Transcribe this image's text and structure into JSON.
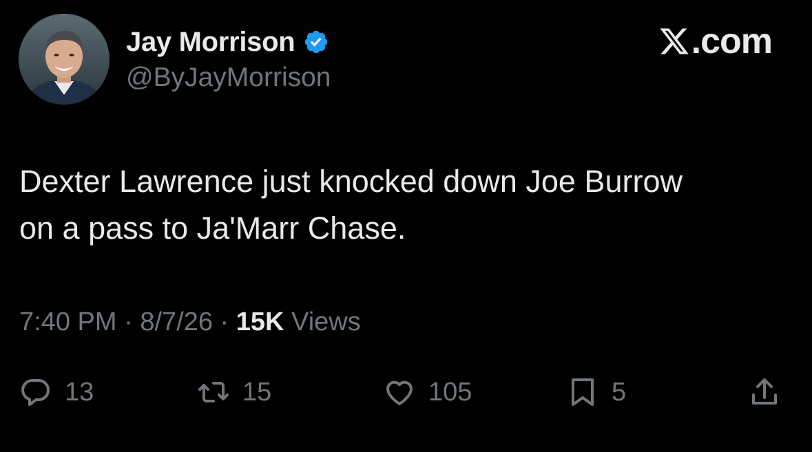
{
  "author": {
    "display_name": "Jay Morrison",
    "handle": "@ByJayMorrison",
    "verified_icon": "verified-badge-icon",
    "verified_color": "#1d9bf0"
  },
  "brand": {
    "text": ".com",
    "icon": "x-logo-icon"
  },
  "tweet": {
    "text": "Dexter Lawrence just knocked down Joe Burrow\non a pass to Ja'Marr Chase."
  },
  "meta": {
    "time": "7:40 PM",
    "separator": "·",
    "date": "8/7/26",
    "views_count": "15K",
    "views_label": "Views"
  },
  "actions": {
    "reply": {
      "icon": "reply-icon",
      "count": "13"
    },
    "retweet": {
      "icon": "retweet-icon",
      "count": "15"
    },
    "like": {
      "icon": "heart-icon",
      "count": "105"
    },
    "bookmark": {
      "icon": "bookmark-icon",
      "count": "5"
    },
    "share": {
      "icon": "share-icon"
    }
  },
  "colors": {
    "background": "#000000",
    "primary_text": "#e7e9ea",
    "secondary_text": "#71767b"
  }
}
